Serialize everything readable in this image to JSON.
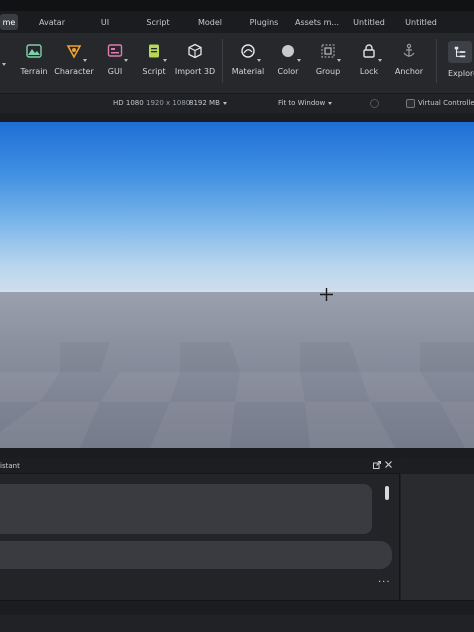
{
  "tabs": [
    {
      "label": "me",
      "active": true
    },
    {
      "label": "Avatar",
      "active": false
    },
    {
      "label": "UI",
      "active": false
    },
    {
      "label": "Script",
      "active": false
    },
    {
      "label": "Model",
      "active": false
    },
    {
      "label": "Plugins",
      "active": false
    },
    {
      "label": "Assets m...",
      "active": false
    },
    {
      "label": "Untitled",
      "active": false
    },
    {
      "label": "Untitled",
      "active": false
    }
  ],
  "ribbon": {
    "tools": [
      {
        "label": "Terrain",
        "icon": "terrain-icon"
      },
      {
        "label": "Character",
        "icon": "character-icon"
      },
      {
        "label": "GUI",
        "icon": "gui-icon"
      },
      {
        "label": "Script",
        "icon": "script-icon"
      },
      {
        "label": "Import 3D",
        "icon": "import-3d-icon"
      },
      {
        "label": "Material",
        "icon": "material-icon"
      },
      {
        "label": "Color",
        "icon": "color-icon"
      },
      {
        "label": "Group",
        "icon": "group-icon"
      },
      {
        "label": "Lock",
        "icon": "lock-icon"
      },
      {
        "label": "Anchor",
        "icon": "anchor-icon"
      },
      {
        "label": "Explore",
        "icon": "explorer-icon"
      }
    ]
  },
  "viewport_bar": {
    "quality": "HD 1080",
    "resolution": "1920 x 1080",
    "memory": "8192 MB",
    "fit": "Fit to Window",
    "virtual_controller": "Virtual Controller"
  },
  "assistant": {
    "title": "istant",
    "more": "..."
  },
  "colors": {
    "sky_top": "#1e6fd6",
    "sky_horizon": "#cfdeec",
    "ground": "#8c92a0",
    "panel_bg": "#232428"
  }
}
